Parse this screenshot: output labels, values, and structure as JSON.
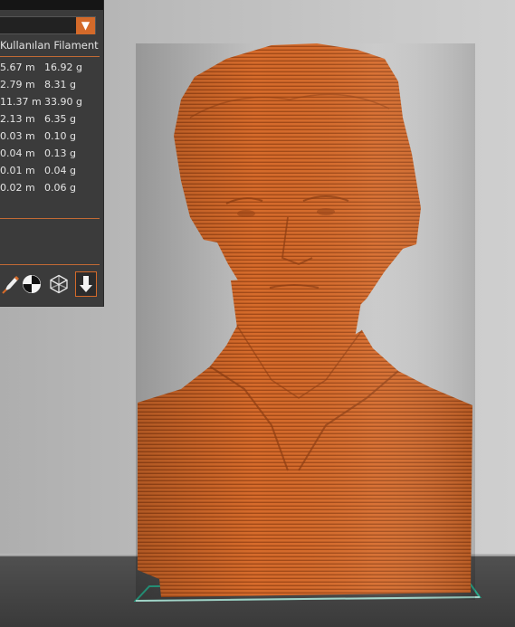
{
  "panel": {
    "header": "Kullanılan Filament",
    "dropdown_value": "",
    "rows": [
      {
        "length": "5.67 m",
        "weight": "16.92 g"
      },
      {
        "length": "2.79 m",
        "weight": "8.31 g"
      },
      {
        "length": "11.37 m",
        "weight": "33.90 g"
      },
      {
        "length": "2.13 m",
        "weight": "6.35 g"
      },
      {
        "length": "0.03 m",
        "weight": "0.10 g"
      },
      {
        "length": "0.04 m",
        "weight": "0.13 g"
      },
      {
        "length": "0.01 m",
        "weight": "0.04 g"
      },
      {
        "length": "0.02 m",
        "weight": "0.06 g"
      }
    ],
    "tools": [
      "paint-brush-icon",
      "cross-section-icon",
      "wireframe-cube-icon",
      "download-arrow-icon"
    ]
  },
  "colors": {
    "accent": "#d46a2a",
    "model": "#d2692c",
    "panel_bg": "#3b3b3b",
    "bed_outline": "#2aa88a"
  }
}
